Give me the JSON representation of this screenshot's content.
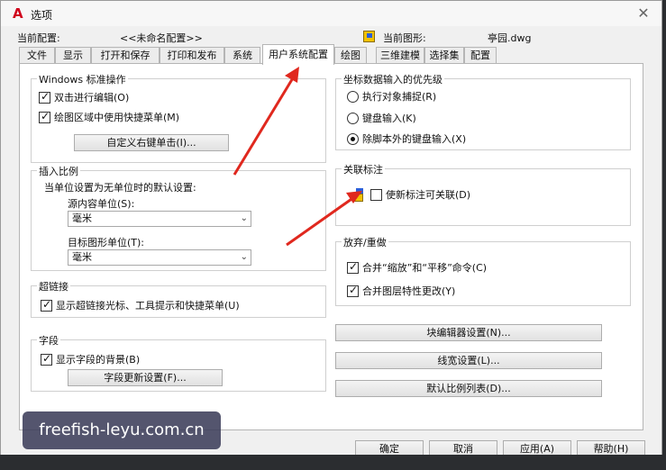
{
  "window": {
    "title": "选项",
    "close": "✕"
  },
  "current_config": {
    "label": "当前配置:",
    "value": "<<未命名配置>>"
  },
  "current_drawing": {
    "label": "当前图形:",
    "value": "亭园.dwg"
  },
  "tabs": [
    "文件",
    "显示",
    "打开和保存",
    "打印和发布",
    "系统",
    "用户系统配置",
    "绘图",
    "三维建模",
    "选择集",
    "配置"
  ],
  "windows_ops": {
    "title": "Windows 标准操作",
    "double_click_edit": "双击进行编辑(O)",
    "shortcut_menus": "绘图区域中使用快捷菜单(M)",
    "right_click_button": "自定义右键单击(I)..."
  },
  "insertion_scale": {
    "title": "插入比例",
    "desc": "当单位设置为无单位时的默认设置:",
    "source_label": "源内容单位(S):",
    "source_value": "毫米",
    "target_label": "目标图形单位(T):",
    "target_value": "毫米"
  },
  "hyperlink": {
    "title": "超链接",
    "option": "显示超链接光标、工具提示和快捷菜单(U)"
  },
  "fields": {
    "title": "字段",
    "option": "显示字段的背景(B)",
    "button": "字段更新设置(F)..."
  },
  "coordinate_priority": {
    "title": "坐标数据输入的优先级",
    "options": [
      "执行对象捕捉(R)",
      "键盘输入(K)",
      "除脚本外的键盘输入(X)"
    ],
    "selected_index": 2
  },
  "assoc_dim": {
    "title": "关联标注",
    "option": "使新标注可关联(D)"
  },
  "undo_redo": {
    "title": "放弃/重做",
    "combine_zoom": "合并“缩放”和“平移”命令(C)",
    "combine_layer": "合并图层特性更改(Y)"
  },
  "right_buttons": [
    "块编辑器设置(N)...",
    "线宽设置(L)...",
    "默认比例列表(D)..."
  ],
  "bottom_buttons": [
    "确定",
    "取消",
    "应用(A)",
    "帮助(H)"
  ],
  "watermark": "freefish-leyu.com.cn",
  "colors": {
    "arrow": "#e0281e",
    "app_icon": "#d0021b"
  }
}
